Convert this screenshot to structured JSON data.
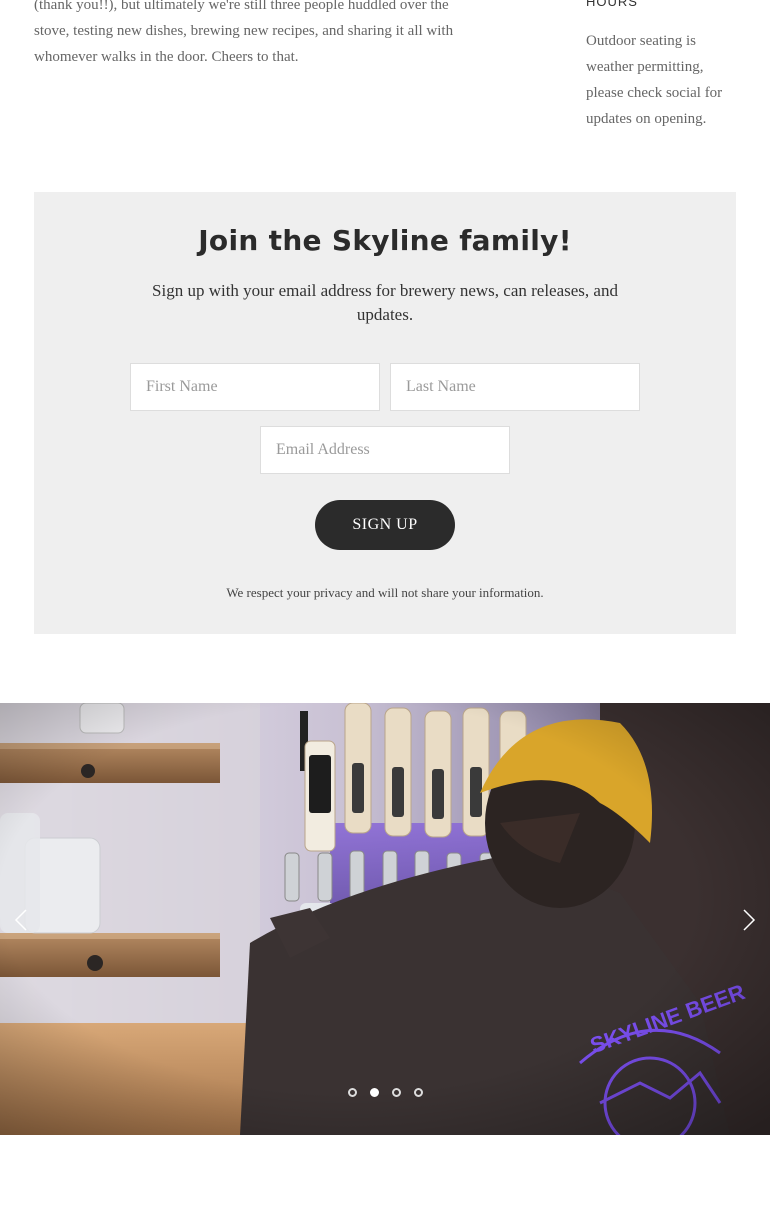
{
  "about": {
    "text": "(thank you!!), but ultimately we're still three people huddled over the stove, testing new dishes, brewing new recipes, and sharing it all with whomever walks in the door. Cheers to that."
  },
  "hours": {
    "heading": "HOURS",
    "note": "Outdoor seating is weather permitting, please check social for updates on opening."
  },
  "signup": {
    "title": "Join the Skyline family!",
    "description": "Sign up with your email address for brewery news, can releases, and updates.",
    "first_name_placeholder": "First Name",
    "last_name_placeholder": "Last Name",
    "email_placeholder": "Email Address",
    "button_label": "SIGN UP",
    "privacy_note": "We respect your privacy and will not share your information."
  },
  "slider": {
    "slide_count": 4,
    "active_slide": 2,
    "prev_icon": "chevron-left-icon",
    "next_icon": "chevron-right-icon"
  },
  "colors": {
    "signup_background": "#efefef",
    "button_background": "#2b2b2b",
    "hoodie_logo": "#7b4ff0",
    "bandana": "#d9a52a"
  }
}
